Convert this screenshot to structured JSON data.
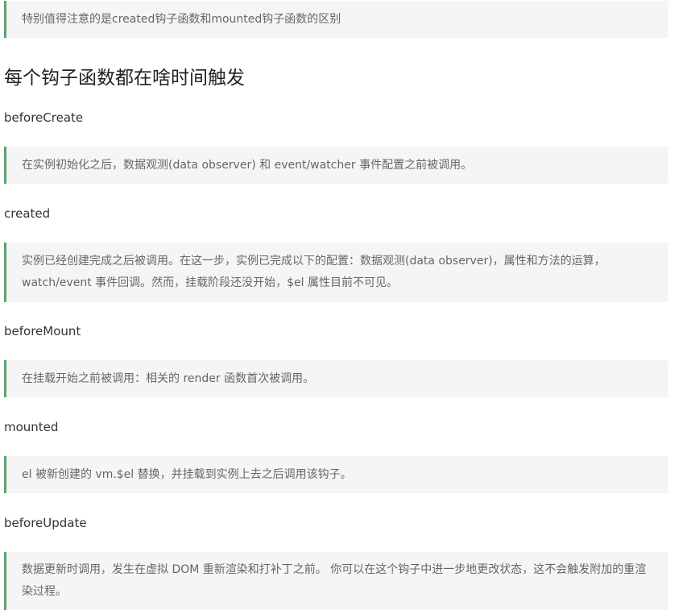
{
  "note": "特别值得注意的是created钩子函数和mounted钩子函数的区别",
  "section_title": "每个钩子函数都在啥时间触发",
  "hooks": [
    {
      "name": "beforeCreate",
      "description": "在实例初始化之后，数据观测(data observer) 和 event/watcher 事件配置之前被调用。"
    },
    {
      "name": "created",
      "description": "实例已经创建完成之后被调用。在这一步，实例已完成以下的配置：数据观测(data observer)，属性和方法的运算，watch/event 事件回调。然而，挂载阶段还没开始，$el 属性目前不可见。"
    },
    {
      "name": "beforeMount",
      "description": "在挂载开始之前被调用：相关的 render 函数首次被调用。"
    },
    {
      "name": "mounted",
      "description": "el 被新创建的 vm.$el 替换，并挂载到实例上去之后调用该钩子。"
    },
    {
      "name": "beforeUpdate",
      "description": "数据更新时调用，发生在虚拟 DOM 重新渲染和打补丁之前。 你可以在这个钩子中进一步地更改状态，这不会触发附加的重渲染过程。"
    }
  ],
  "colors": {
    "quote_border": "#5aa56f",
    "quote_background": "#f5f5f5",
    "quote_text": "#666666",
    "body_text": "#333333",
    "heading_text": "#222222"
  }
}
